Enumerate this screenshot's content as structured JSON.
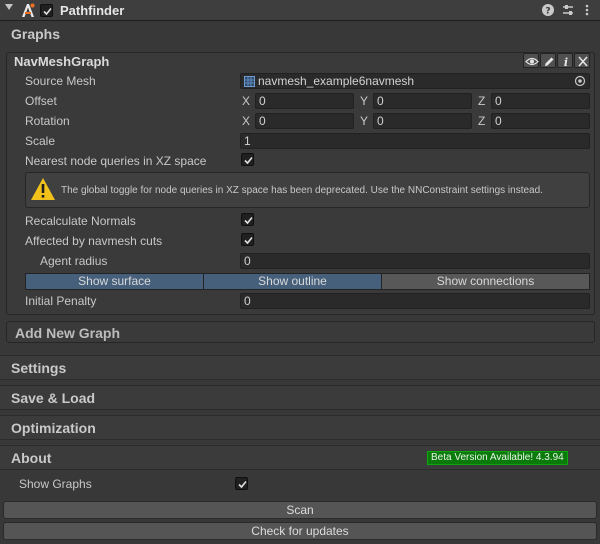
{
  "component": {
    "title": "Pathfinder",
    "enabled": true
  },
  "graphs": {
    "section_title": "Graphs",
    "graph": {
      "name": "NavMeshGraph",
      "source_mesh_label": "Source Mesh",
      "source_mesh_value": "navmesh_example6navmesh",
      "offset_label": "Offset",
      "offset": {
        "x": "0",
        "y": "0",
        "z": "0"
      },
      "rotation_label": "Rotation",
      "rotation": {
        "x": "0",
        "y": "0",
        "z": "0"
      },
      "axis_labels": {
        "x": "X",
        "y": "Y",
        "z": "Z"
      },
      "scale_label": "Scale",
      "scale_value": "1",
      "nearest_xz_label": "Nearest node queries in XZ space",
      "nearest_xz_checked": true,
      "warning_text": "The global toggle for node queries in XZ space has been deprecated. Use the NNConstraint settings instead.",
      "recalc_normals_label": "Recalculate Normals",
      "recalc_normals_checked": true,
      "navmesh_cuts_label": "Affected by navmesh cuts",
      "navmesh_cuts_checked": true,
      "agent_radius_label": "Agent radius",
      "agent_radius_value": "0",
      "show_surface_label": "Show surface",
      "show_outline_label": "Show outline",
      "show_connections_label": "Show connections",
      "initial_penalty_label": "Initial Penalty",
      "initial_penalty_value": "0"
    },
    "add_new_graph_label": "Add New Graph"
  },
  "sections": {
    "settings": "Settings",
    "save_load": "Save & Load",
    "optimization": "Optimization",
    "about": "About"
  },
  "about": {
    "beta_badge": "Beta Version Available! 4.3.94",
    "show_graphs_label": "Show Graphs",
    "show_graphs_checked": true
  },
  "buttons": {
    "scan": "Scan",
    "check_updates": "Check for updates"
  },
  "colors": {
    "toggle_active": "#46607c",
    "beta_bg": "#0a7a0a",
    "warning_yellow": "#f2c21a"
  },
  "icons": {
    "help": "help-icon",
    "presets": "presets-icon",
    "menu": "kebab-menu-icon",
    "eye": "eye-icon",
    "pencil": "pencil-icon",
    "info": "info-icon",
    "close": "close-icon",
    "mesh": "mesh-icon",
    "picker": "object-picker-icon",
    "warning": "warning-icon"
  }
}
